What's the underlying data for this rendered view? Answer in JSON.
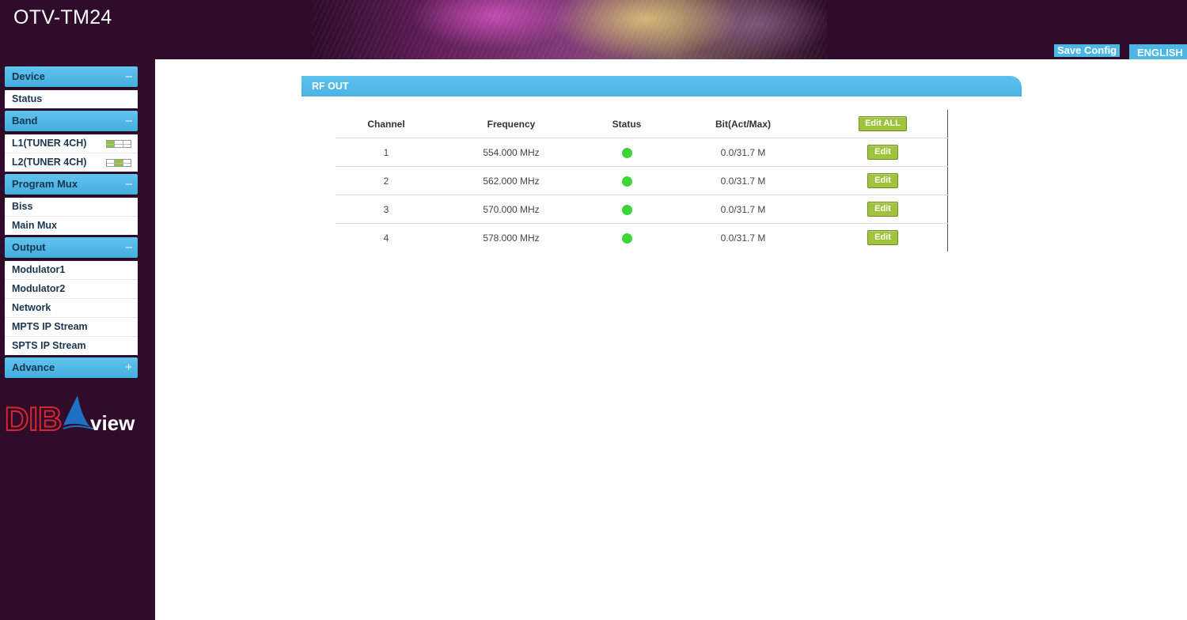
{
  "header": {
    "title": "OTV-TM24",
    "save_label": "Save Config",
    "language": "ENGLISH"
  },
  "sidebar": {
    "groups": [
      {
        "label": "Device",
        "toggle": "–",
        "items": [
          {
            "label": "Status"
          }
        ]
      },
      {
        "label": "Band",
        "toggle": "–",
        "items": [
          {
            "label": "L1(TUNER 4CH)",
            "icon": "band-slot-icon",
            "active_slot": 1
          },
          {
            "label": "L2(TUNER 4CH)",
            "icon": "band-slot-icon",
            "active_slot": 2
          }
        ]
      },
      {
        "label": "Program Mux",
        "toggle": "–",
        "items": [
          {
            "label": "Biss"
          },
          {
            "label": "Main Mux"
          }
        ]
      },
      {
        "label": "Output",
        "toggle": "–",
        "items": [
          {
            "label": "Modulator1"
          },
          {
            "label": "Modulator2"
          },
          {
            "label": "Network"
          },
          {
            "label": "MPTS IP Stream"
          },
          {
            "label": "SPTS IP Stream"
          }
        ]
      },
      {
        "label": "Advance",
        "toggle": "+"
      }
    ],
    "logo": {
      "text_left": "DIB",
      "text_right": "view"
    }
  },
  "panel": {
    "title": "RF OUT",
    "columns": [
      "Channel",
      "Frequency",
      "Status",
      "Bit(Act/Max)"
    ],
    "edit_all_label": "Edit ALL",
    "edit_label": "Edit",
    "rows": [
      {
        "channel": "1",
        "frequency": "554.000 MHz",
        "status": "active",
        "bit": "0.0/31.7 M"
      },
      {
        "channel": "2",
        "frequency": "562.000 MHz",
        "status": "active",
        "bit": "0.0/31.7 M"
      },
      {
        "channel": "3",
        "frequency": "570.000 MHz",
        "status": "active",
        "bit": "0.0/31.7 M"
      },
      {
        "channel": "4",
        "frequency": "578.000 MHz",
        "status": "active",
        "bit": "0.0/31.7 M"
      }
    ]
  },
  "colors": {
    "background": "#2e0c2a",
    "accent_blue": "#4cb7e6",
    "button_green": "#9fc33c",
    "status_green": "#3fd53a",
    "logo_red": "#d8262e",
    "logo_blue": "#1f6fc2"
  }
}
